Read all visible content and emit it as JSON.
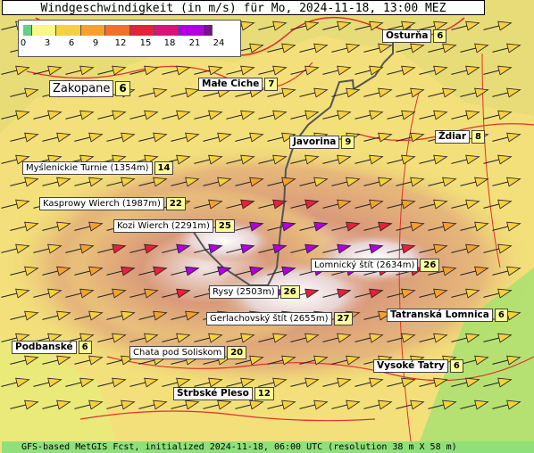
{
  "title": "Windgeschwindigkeit (in m/s) für Mo, 2024-11-18, 13:00 MEZ",
  "footer": "GFS-based MetGIS Fcst, initialized 2024-11-18, 06:00 UTC  (resolution 38 m X 58 m)",
  "legend": {
    "ticks": [
      "0",
      "3",
      "6",
      "9",
      "12",
      "15",
      "18",
      "21",
      "24"
    ],
    "colors": [
      "#66cc88",
      "#f7f78a",
      "#f7d040",
      "#f5a030",
      "#f07030",
      "#e8203a",
      "#e0107a",
      "#b000e0",
      "#7a1090"
    ]
  },
  "places": [
    {
      "name": "Osturňa",
      "value": "6"
    },
    {
      "name": "Zakopane",
      "value": "6"
    },
    {
      "name": "Małe Ciche",
      "value": "7"
    },
    {
      "name": "Ždiar",
      "value": "8"
    },
    {
      "name": "Javorina",
      "value": "9"
    },
    {
      "name": "Myślenickie Turnie (1354m)",
      "value": "14"
    },
    {
      "name": "Kasprowy Wierch (1987m)",
      "value": "22"
    },
    {
      "name": "Kozi Wierch (2291m)",
      "value": "25"
    },
    {
      "name": "Lomnický štít (2634m)",
      "value": "26"
    },
    {
      "name": "Rysy (2503m)",
      "value": "26"
    },
    {
      "name": "Gerlachovský štít (2655m)",
      "value": "27"
    },
    {
      "name": "Tatranská Lomnica",
      "value": "6"
    },
    {
      "name": "Podbanské",
      "value": "6"
    },
    {
      "name": "Chata pod Soliskom",
      "value": "20"
    },
    {
      "name": "Vysoké Tatry",
      "value": "6"
    },
    {
      "name": "Štrbské Pleso",
      "value": "12"
    }
  ]
}
